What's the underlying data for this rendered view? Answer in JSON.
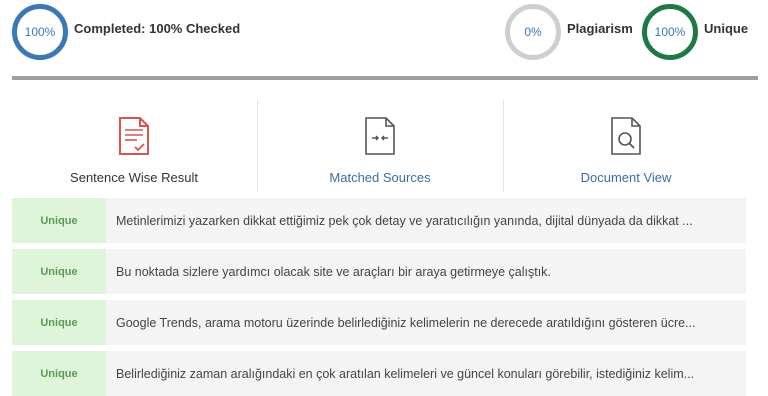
{
  "summary": {
    "progress_value": "100%",
    "status_text": "Completed: 100% Checked",
    "plagiarism_value": "0%",
    "plagiarism_label": "Plagiarism",
    "unique_value": "100%",
    "unique_label": "Unique"
  },
  "colors": {
    "progress_ring": "#3c78b4",
    "plagiarism_ring": "#cfcfcf",
    "unique_ring": "#1e7a45",
    "badge_bg": "#dff5d9",
    "badge_text": "#5a9a5a",
    "link": "#3c6fa0",
    "icon_red": "#d9534f"
  },
  "tabs": [
    {
      "label": "Sentence Wise Result",
      "icon": "document-check-icon"
    },
    {
      "label": "Matched Sources",
      "icon": "document-compare-icon"
    },
    {
      "label": "Document View",
      "icon": "document-search-icon"
    }
  ],
  "results": [
    {
      "badge": "Unique",
      "text": "Metinlerimizi yazarken dikkat ettiğimiz pek çok detay ve yaratıcılığın yanında, dijital dünyada da dikkat ..."
    },
    {
      "badge": "Unique",
      "text": "Bu noktada sizlere yardımcı olacak site ve araçları bir araya getirmeye çalıştık."
    },
    {
      "badge": "Unique",
      "text": "Google Trends, arama motoru üzerinde belirlediğiniz kelimelerin ne derecede aratıldığını gösteren ücre..."
    },
    {
      "badge": "Unique",
      "text": "Belirlediğiniz zaman aralığındaki en çok aratılan kelimeleri ve güncel konuları görebilir, istediğiniz kelim..."
    }
  ]
}
